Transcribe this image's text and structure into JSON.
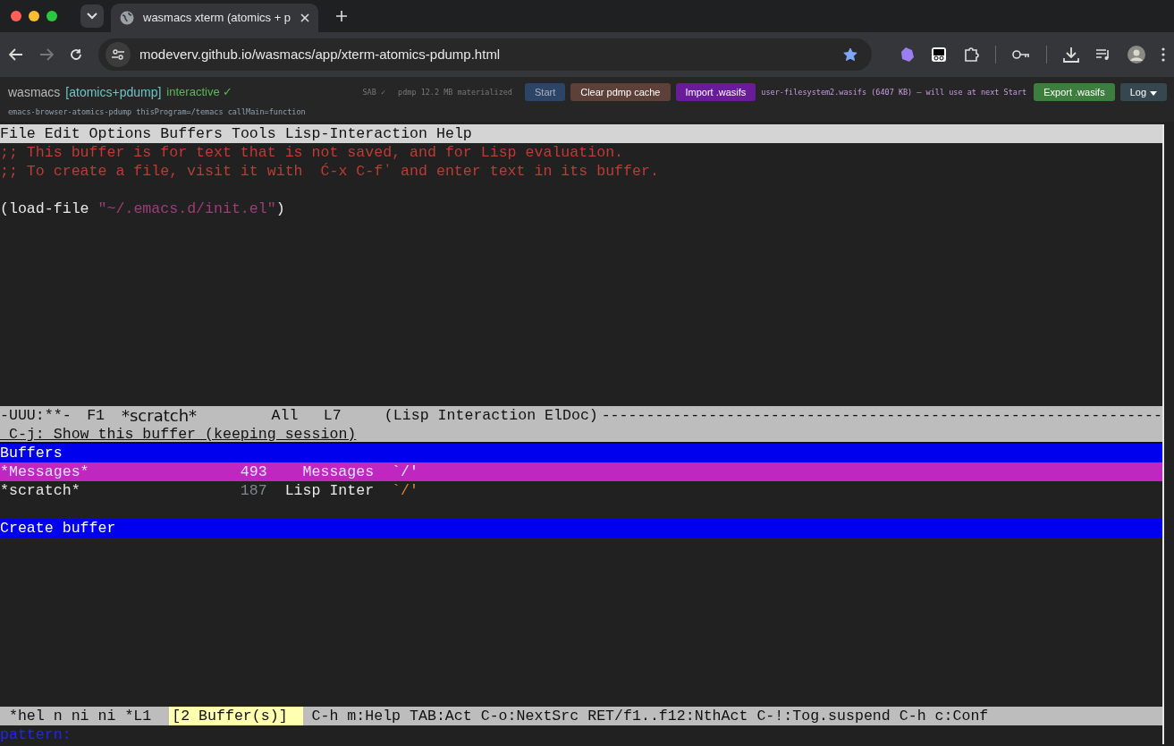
{
  "browser": {
    "tab_title": "wasmacs xterm (atomics + p",
    "url": "modeverv.github.io/wasmacs/app/xterm-atomics-pdump.html",
    "bookmarked": true,
    "forward_disabled": true
  },
  "header": {
    "app_name": "wasmacs",
    "variant": "[atomics+pdump]",
    "state": "interactive ✓",
    "sab": "SAB ✓",
    "pdmp": "pdmp 12.2 MB materialized",
    "subtitle": "emacs-browser-atomics-pdump thisProgram=/temacs callMain=function",
    "buttons": [
      {
        "label": "Start",
        "kind": "start",
        "disabled": true
      },
      {
        "label": "Clear pdmp cache",
        "kind": "clear"
      },
      {
        "label": "Import .wasifs",
        "kind": "import"
      }
    ],
    "import_status": "user-filesystem2.wasifs (6407 KB) — will use at next Start",
    "buttons_right": [
      {
        "label": "Export .wasifs",
        "kind": "export"
      },
      {
        "label": "Log",
        "kind": "log"
      }
    ]
  },
  "emacs": {
    "menu": [
      "File",
      "Edit",
      "Options",
      "Buffers",
      "Tools",
      "Lisp-Interaction",
      "Help"
    ],
    "buffer_lines": [
      {
        "kind": "comment",
        "text": ";; This buffer is for text that is not saved, and for Lisp evaluation."
      },
      {
        "kind": "comment",
        "text": ";; To create a file, visit it with  Ć-x C-fʼ and enter text in its buffer."
      },
      {
        "kind": "blank"
      },
      {
        "kind": "code",
        "text": "(load-file ",
        "string": "\"~/.emacs.d/init.el\"",
        "close": ")"
      }
    ],
    "mode_line": {
      "flags": "-UUU:**-",
      "frame": "F1",
      "buffer": "*scratch*",
      "position": "All",
      "line": "L7",
      "modes": "(Lisp Interaction ElDoc)",
      "fill": "---------------------------------------------------------------"
    },
    "helm": {
      "header": " C-j: Show this buffer (keeping session)",
      "source": "Buffers",
      "buffers": [
        {
          "name": "*Messages*",
          "size": "493",
          "mode": "Messages",
          "dir": "`/'",
          "selected": true
        },
        {
          "name": "*scratch*",
          "size": "187",
          "mode": "Lisp Inter",
          "dir": "`/'",
          "selected": false
        }
      ],
      "action_source": "Create buffer",
      "mode_line": {
        "name": " *hel n ni ni *",
        "line": "L1",
        "count": "[2 Buffer(s)]",
        "help": "C-h m:Help TAB:Act C-o:NextSrc RET/f1..f12:NthAct C-!:Tog.suspend C-h c:Conf"
      },
      "prompt": "pattern:"
    }
  }
}
